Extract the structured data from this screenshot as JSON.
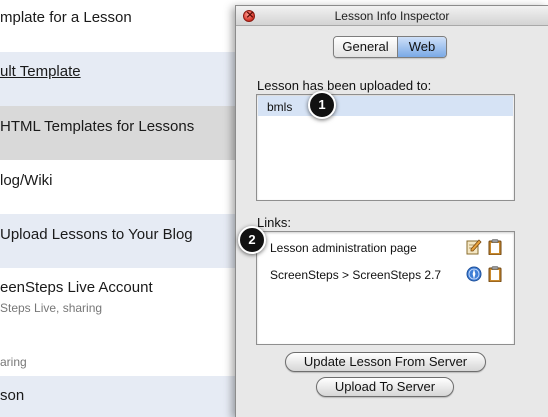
{
  "background_list": {
    "rows": [
      {
        "title": "mplate for a Lesson"
      },
      {
        "title": "ult Template"
      },
      {
        "title": "HTML Templates for Lessons"
      },
      {
        "title": "log/Wiki"
      },
      {
        "title": "Upload Lessons to Your Blog"
      },
      {
        "title": "eenSteps Live Account",
        "subtitle": "Steps Live, sharing"
      },
      {
        "subtitle": "aring"
      },
      {
        "title": "son"
      }
    ]
  },
  "inspector": {
    "title": "Lesson Info Inspector",
    "tabs": {
      "general": "General",
      "web": "Web",
      "selected": "Web"
    },
    "uploaded_label": "Lesson has been uploaded to:",
    "uploaded_items": [
      "bmls"
    ],
    "links_label": "Links:",
    "links": [
      {
        "text": "Lesson administration page",
        "icons": [
          "edit-icon",
          "clipboard-icon"
        ]
      },
      {
        "text": "ScreenSteps > ScreenSteps 2.7",
        "icons": [
          "safari-icon",
          "clipboard-icon"
        ]
      }
    ],
    "update_button": "Update Lesson From Server",
    "upload_button": "Upload To Server"
  },
  "callouts": [
    "1",
    "2"
  ],
  "colors": {
    "selected_tab": "#7aa9e6",
    "selected_row": "#d6e3f5",
    "callout": "#111111"
  }
}
